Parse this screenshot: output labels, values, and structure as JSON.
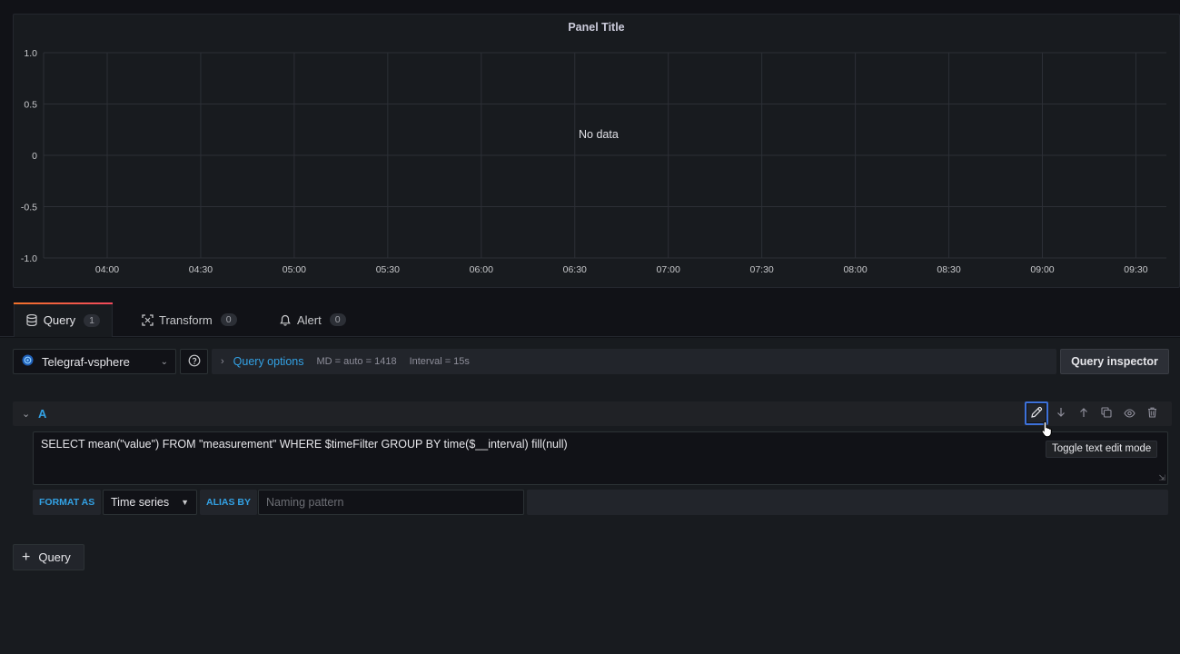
{
  "panel": {
    "title": "Panel Title",
    "no_data": "No data"
  },
  "chart_data": {
    "type": "line",
    "title": "Panel Title",
    "x_ticks": [
      "04:00",
      "04:30",
      "05:00",
      "05:30",
      "06:00",
      "06:30",
      "07:00",
      "07:30",
      "08:00",
      "08:30",
      "09:00",
      "09:30"
    ],
    "y_ticks": [
      "1.0",
      "0.5",
      "0",
      "-0.5",
      "-1.0"
    ],
    "ylim": [
      -1.0,
      1.0
    ],
    "series": [],
    "grid": true,
    "annotation": "No data"
  },
  "tabs": [
    {
      "label": "Query",
      "count": "1",
      "icon": "database-icon"
    },
    {
      "label": "Transform",
      "count": "0",
      "icon": "transform-icon"
    },
    {
      "label": "Alert",
      "count": "0",
      "icon": "bell-icon"
    }
  ],
  "datasource": {
    "name": "Telegraf-vsphere",
    "icon": "vsphere-icon"
  },
  "query_options": {
    "label": "Query options",
    "md": "MD = auto = 1418",
    "interval": "Interval = 15s"
  },
  "query_inspector_label": "Query inspector",
  "query": {
    "ref_id": "A",
    "text": "SELECT mean(\"value\") FROM \"measurement\" WHERE $timeFilter GROUP BY time($__interval) fill(null)",
    "tooltip": "Toggle text edit mode",
    "format_as_label": "FORMAT AS",
    "format_value": "Time series",
    "alias_label": "ALIAS BY",
    "alias_placeholder": "Naming pattern",
    "alias_value": ""
  },
  "add_query_label": "Query",
  "colors": {
    "accent_blue": "#33a2e5",
    "focus_blue": "#3d71d9",
    "tab_gradient_start": "#f2722b",
    "tab_gradient_end": "#f2495c"
  }
}
